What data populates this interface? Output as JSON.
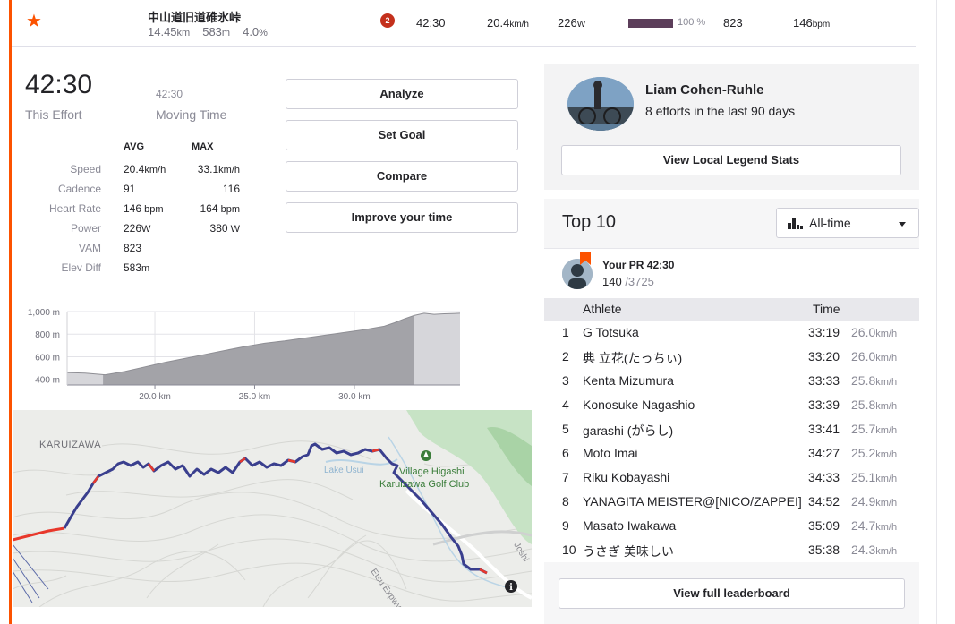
{
  "segment": {
    "name": "中山道旧道碓氷峠",
    "distance": "14.45",
    "distance_unit": "km",
    "elevation": "583",
    "elevation_unit": "m",
    "grade": "4.0",
    "grade_unit": "%",
    "badge": "2",
    "time": "42:30",
    "speed": "20.4",
    "speed_unit": "km/h",
    "power": "226",
    "power_unit": "W",
    "progress": 1.0,
    "progress_label": "100 %",
    "vam": "823",
    "heart_rate": "146",
    "heart_rate_unit": "bpm"
  },
  "effort": {
    "elapsed": "42:30",
    "elapsed_label": "This Effort",
    "moving": "42:30",
    "moving_label": "Moving Time"
  },
  "stats": {
    "avg_header": "AVG",
    "max_header": "MAX",
    "rows": [
      {
        "label": "Speed",
        "avg": "20.4",
        "avg_unit": "km/h",
        "max": "33.1",
        "max_unit": "km/h"
      },
      {
        "label": "Cadence",
        "avg": "91",
        "avg_unit": "",
        "max": "116",
        "max_unit": ""
      },
      {
        "label": "Heart Rate",
        "avg": "146",
        "avg_unit": " bpm",
        "max": "164",
        "max_unit": " bpm"
      },
      {
        "label": "Power",
        "avg": "226",
        "avg_unit": "W",
        "max": "380",
        "max_unit": " W"
      },
      {
        "label": "VAM",
        "avg": "823",
        "avg_unit": "",
        "max": "",
        "max_unit": ""
      },
      {
        "label": "Elev Diff",
        "avg": "583",
        "avg_unit": "m",
        "max": "",
        "max_unit": ""
      }
    ]
  },
  "actions": {
    "analyze": "Analyze",
    "set_goal": "Set Goal",
    "compare": "Compare",
    "improve": "Improve your time"
  },
  "chart_data": {
    "type": "area",
    "x": [
      15.6,
      16.5,
      17.5,
      18.5,
      19.5,
      20.5,
      21.5,
      22.5,
      23.5,
      24.5,
      25.5,
      26.5,
      27.5,
      28.5,
      29.5,
      30.5,
      31.5,
      32.0,
      32.5,
      33.0,
      33.5,
      34.0,
      34.5,
      35.3
    ],
    "y": [
      460,
      455,
      440,
      470,
      510,
      550,
      585,
      620,
      655,
      690,
      720,
      740,
      765,
      790,
      815,
      840,
      870,
      900,
      935,
      965,
      985,
      975,
      980,
      985
    ],
    "xticks": [
      "20.0 km",
      "25.0 km",
      "30.0 km"
    ],
    "xtick_values": [
      20,
      25,
      30
    ],
    "yticks": [
      "1,000 m",
      "800 m",
      "600 m",
      "400 m"
    ],
    "ytick_values": [
      1000,
      800,
      600,
      400
    ],
    "segment_start": 17.4,
    "segment_end": 33.0,
    "xlim": [
      15.6,
      35.3
    ],
    "ylim": [
      350,
      1000
    ],
    "grid": true
  },
  "map": {
    "labels": {
      "karuizawa": "KARUIZAWA",
      "lake": "Lake Usui",
      "golf1": "Village Higashi",
      "golf2": "Karuizawa Golf Club",
      "road1": "Joshi",
      "road2": "Etsu Expwy"
    }
  },
  "local_legend": {
    "name": "Liam Cohen-Ruhle",
    "efforts": "8 efforts in the last 90 days",
    "button": "View Local Legend Stats"
  },
  "leaderboard": {
    "title": "Top 10",
    "filter": "All-time",
    "pr_label": "Your PR 42:30",
    "pr_rank": "140",
    "pr_total": " /3725",
    "col_athlete": "Athlete",
    "col_time": "Time",
    "speed_unit": "km/h",
    "rows": [
      {
        "rank": "1",
        "name": "G Totsuka",
        "time": "33:19",
        "speed": "26.0"
      },
      {
        "rank": "2",
        "name": "典 立花(たっちぃ)",
        "time": "33:20",
        "speed": "26.0"
      },
      {
        "rank": "3",
        "name": "Kenta Mizumura",
        "time": "33:33",
        "speed": "25.8"
      },
      {
        "rank": "4",
        "name": "Konosuke Nagashio",
        "time": "33:39",
        "speed": "25.8"
      },
      {
        "rank": "5",
        "name": "garashi (がらし)",
        "time": "33:41",
        "speed": "25.7"
      },
      {
        "rank": "6",
        "name": "Moto Imai",
        "time": "34:27",
        "speed": "25.2"
      },
      {
        "rank": "7",
        "name": "Riku Kobayashi",
        "time": "34:33",
        "speed": "25.1"
      },
      {
        "rank": "8",
        "name": "YANAGITA MEISTER@[NICO/ZAPPEI]",
        "time": "34:52",
        "speed": "24.9"
      },
      {
        "rank": "9",
        "name": "Masato Iwakawa",
        "time": "35:09",
        "speed": "24.7"
      },
      {
        "rank": "10",
        "name": "うさぎ 美味しい",
        "time": "35:38",
        "speed": "24.3"
      }
    ],
    "full_button": "View full leaderboard"
  }
}
